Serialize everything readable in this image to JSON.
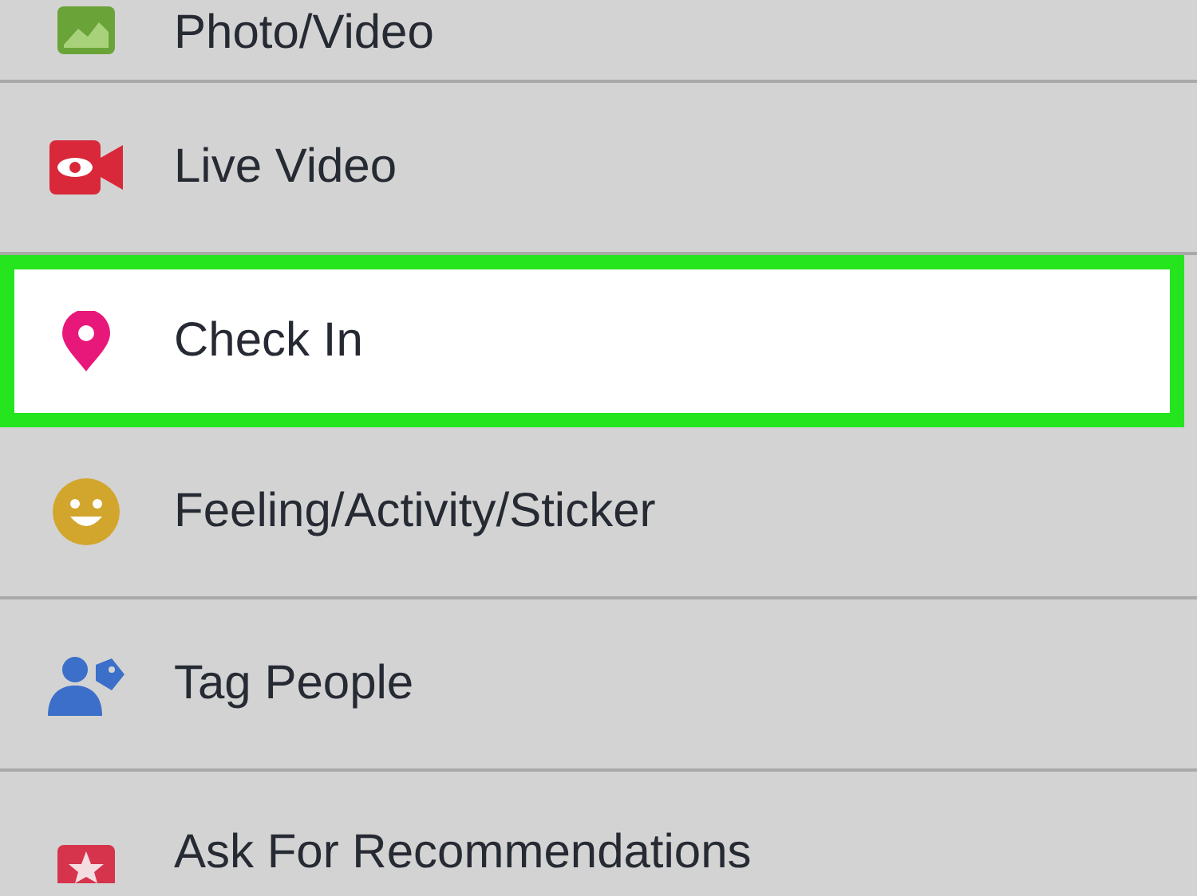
{
  "menu": {
    "items": [
      {
        "label": "Photo/Video",
        "selected": false
      },
      {
        "label": "Live Video",
        "selected": false
      },
      {
        "label": "Check In",
        "selected": true
      },
      {
        "label": "Feeling/Activity/Sticker",
        "selected": false
      },
      {
        "label": "Tag People",
        "selected": false
      },
      {
        "label": "Ask For Recommendations",
        "selected": false
      }
    ]
  }
}
